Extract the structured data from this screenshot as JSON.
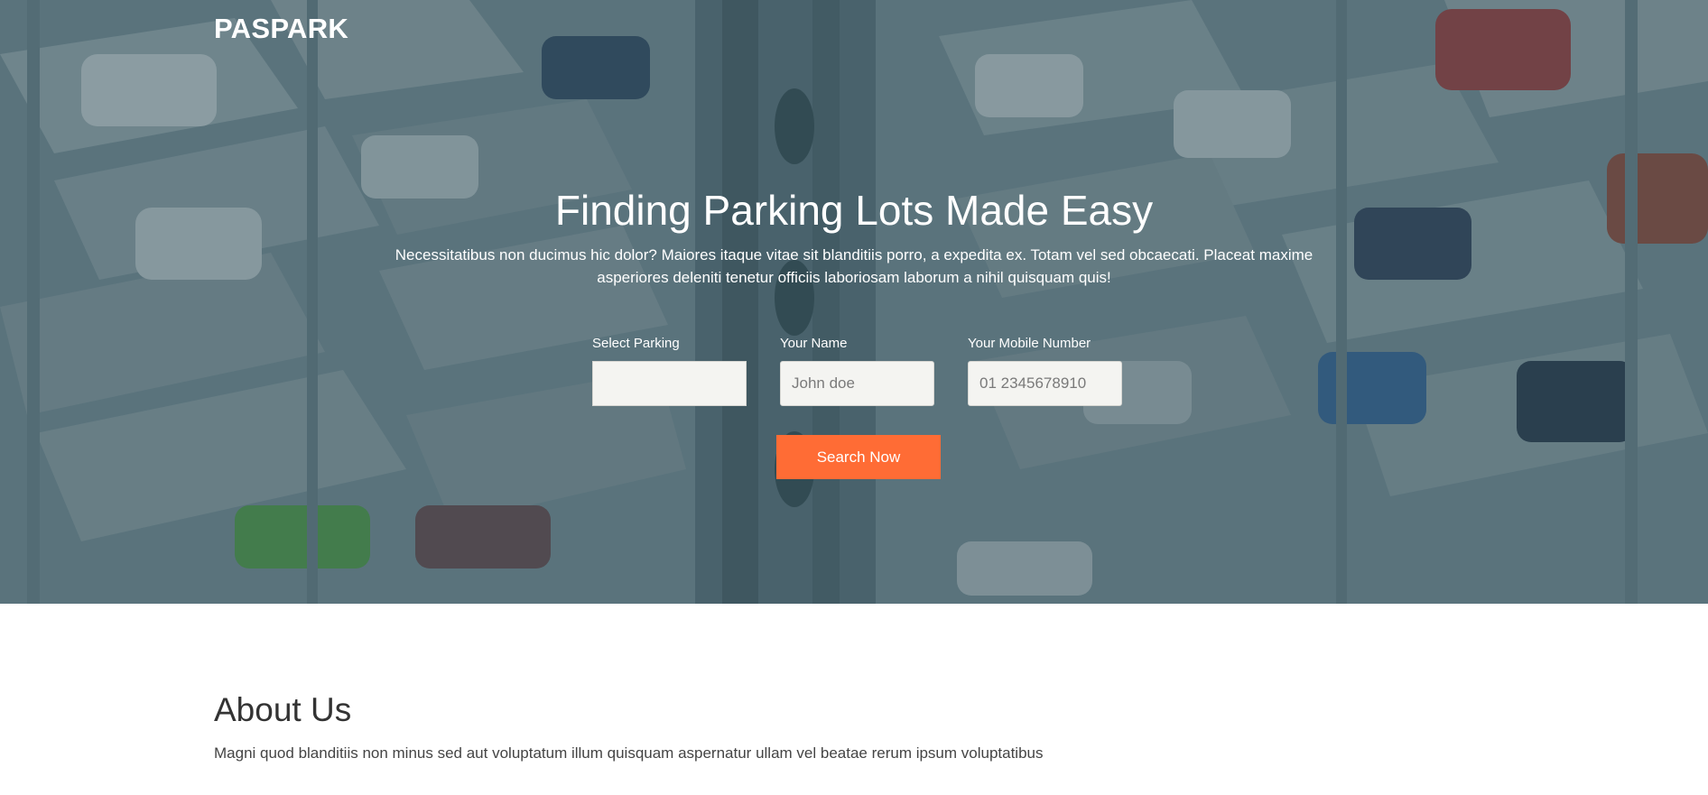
{
  "brand": "PASPARK",
  "hero": {
    "title": "Finding Parking Lots Made Easy",
    "description": "Necessitatibus non ducimus hic dolor? Maiores itaque vitae sit blanditiis porro, a expedita ex. Totam vel sed obcaecati. Placeat maxime asperiores deleniti tenetur officiis laboriosam laborum a nihil quisquam quis!"
  },
  "form": {
    "parking": {
      "label": "Select Parking",
      "value": ""
    },
    "name": {
      "label": "Your Name",
      "placeholder": "John doe"
    },
    "mobile": {
      "label": "Your Mobile Number",
      "placeholder": "01 2345678910"
    },
    "submit_label": "Search Now"
  },
  "about": {
    "title": "About Us",
    "text": "Magni quod blanditiis non minus sed aut voluptatum illum quisquam aspernatur ullam vel beatae rerum ipsum voluptatibus"
  },
  "colors": {
    "accent": "#ff6c35",
    "overlay": "#264450",
    "text_dark": "#333333"
  }
}
